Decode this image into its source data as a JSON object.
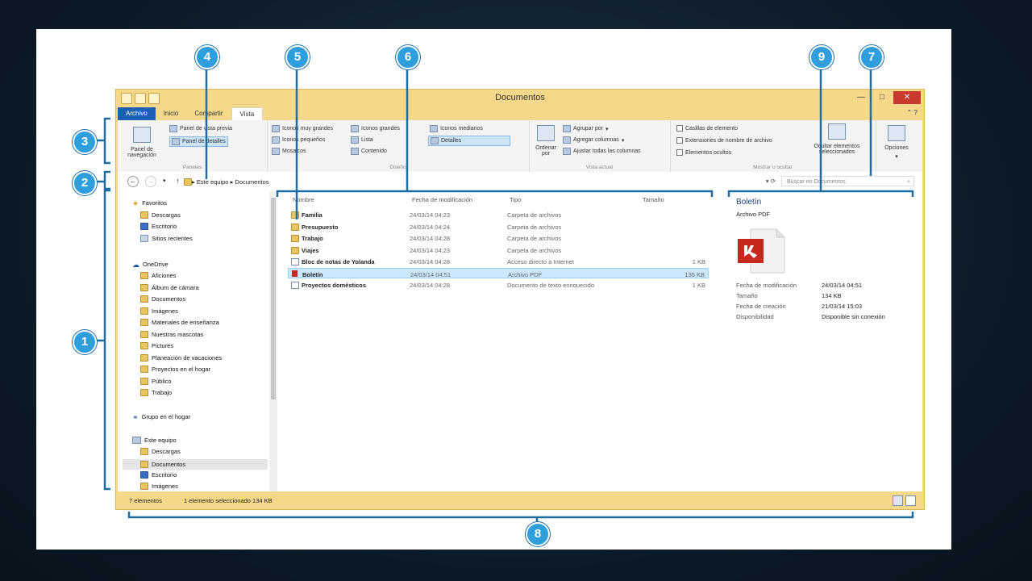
{
  "window": {
    "title": "Documentos"
  },
  "tabs": [
    "Archivo",
    "Inicio",
    "Compartir",
    "Vista"
  ],
  "ribbon": {
    "panes": {
      "nav": "Panel de navegación",
      "preview": "Panel de vista previa",
      "details": "Panel de detalles",
      "label": "Paneles"
    },
    "layout": {
      "items": [
        "Iconos muy grandes",
        "Iconos grandes",
        "Iconos medianos",
        "Iconos pequeños",
        "Lista",
        "Detalles",
        "Mosaicos",
        "Contenido"
      ],
      "label": "Diseño"
    },
    "current": {
      "sort": "Ordenar por",
      "group": "Agrupar por",
      "addcol": "Agregar columnas",
      "fit": "Ajustar todas las columnas",
      "label": "Vista actual"
    },
    "showhide": {
      "checks": [
        "Casillas de elemento",
        "Extensiones de nombre de archivo",
        "Elementos ocultos"
      ],
      "hide": "Ocultar elementos seleccionados",
      "label": "Mostrar u ocultar"
    },
    "options": "Opciones"
  },
  "address": {
    "path": [
      "Este equipo",
      "Documentos"
    ],
    "search_placeholder": "Buscar en Documentos"
  },
  "nav": {
    "favorites": {
      "label": "Favoritos",
      "items": [
        "Descargas",
        "Escritorio",
        "Sitios recientes"
      ]
    },
    "onedrive": {
      "label": "OneDrive",
      "items": [
        "Aficiones",
        "Álbum de cámara",
        "Documentos",
        "Imágenes",
        "Materiales de enseñanza",
        "Nuestras mascotas",
        "Pictures",
        "Planeación de vacaciones",
        "Proyectos en el hogar",
        "Público",
        "Trabajo"
      ]
    },
    "homegroup": "Grupo en el hogar",
    "thispc": {
      "label": "Este equipo",
      "items": [
        "Descargas",
        "Documentos",
        "Escritorio",
        "Imágenes"
      ]
    }
  },
  "columns": [
    "Nombre",
    "Fecha de modificación",
    "Tipo",
    "Tamaño"
  ],
  "files": [
    {
      "name": "Familia",
      "date": "24/03/14 04:23",
      "type": "Carpeta de archivos",
      "size": ""
    },
    {
      "name": "Presupuesto",
      "date": "24/03/14 04:24",
      "type": "Carpeta de archivos",
      "size": ""
    },
    {
      "name": "Trabajo",
      "date": "24/03/14 04:28",
      "type": "Carpeta de archivos",
      "size": ""
    },
    {
      "name": "Viajes",
      "date": "24/03/14 04:23",
      "type": "Carpeta de archivos",
      "size": ""
    },
    {
      "name": "Bloc de notas de Yolanda",
      "date": "24/03/14 04:28",
      "type": "Acceso directo a Internet",
      "size": "1 KB"
    },
    {
      "name": "Boletín",
      "date": "24/03/14 04:51",
      "type": "Archivo PDF",
      "size": "135 KB"
    },
    {
      "name": "Proyectos domésticos",
      "date": "24/03/14 04:28",
      "type": "Documento de texto enriquecido",
      "size": "1 KB"
    }
  ],
  "preview": {
    "title": "Boletín",
    "subtitle": "Archivo PDF",
    "props": [
      {
        "k": "Fecha de modificación",
        "v": "24/03/14 04:51"
      },
      {
        "k": "Tamaño",
        "v": "134 KB"
      },
      {
        "k": "Fecha de creación",
        "v": "21/03/14 15:03"
      },
      {
        "k": "Disponibilidad",
        "v": "Disponible sin conexión"
      }
    ]
  },
  "status": {
    "count": "7 elementos",
    "selected": "1 elemento seleccionado  134 KB"
  },
  "callouts": [
    "1",
    "2",
    "3",
    "4",
    "5",
    "6",
    "7",
    "8",
    "9"
  ],
  "colors": {
    "callout": "#2e9fdc",
    "bracket": "#1d6ea0",
    "selection": "#cce8ff",
    "file_tab": "#1d5fb8"
  }
}
